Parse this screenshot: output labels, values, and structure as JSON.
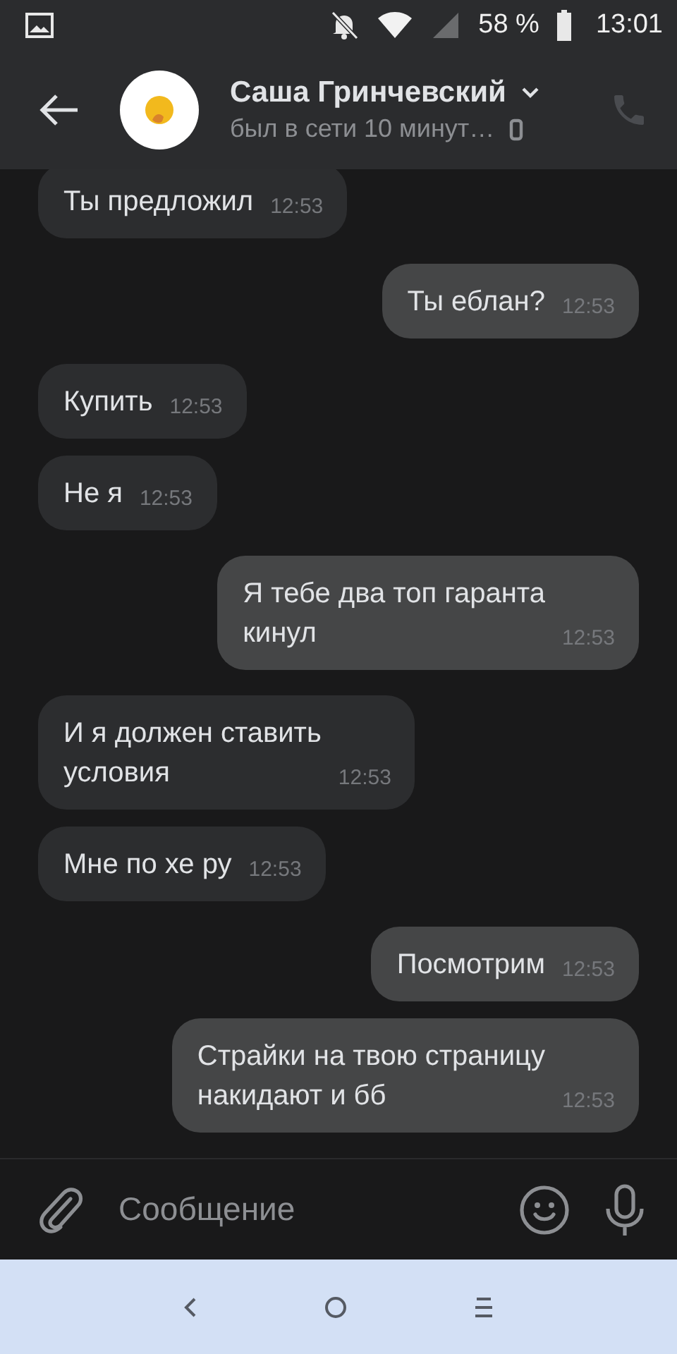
{
  "status_bar": {
    "battery": "58 %",
    "time": "13:01"
  },
  "header": {
    "name": "Саша Гринчевский",
    "status": "был в сети 10 минут…"
  },
  "messages": [
    {
      "text": "Ты предложил",
      "time": "12:53",
      "outgoing": false
    },
    {
      "text": "Ты еблан?",
      "time": "12:53",
      "outgoing": true
    },
    {
      "text": "Купить",
      "time": "12:53",
      "outgoing": false
    },
    {
      "text": "Не я",
      "time": "12:53",
      "outgoing": false
    },
    {
      "text": "Я тебе два топ гаранта\nкинул",
      "time": "12:53",
      "outgoing": true
    },
    {
      "text": "И я должен ставить\nусловия",
      "time": "12:53",
      "outgoing": false
    },
    {
      "text": "Мне по хе ру",
      "time": "12:53",
      "outgoing": false
    },
    {
      "text": "Посмотрим",
      "time": "12:53",
      "outgoing": true
    },
    {
      "text": "Страйки на твою страницу\nнакидают и бб",
      "time": "12:53",
      "outgoing": true
    }
  ],
  "composer": {
    "placeholder": "Сообщение"
  }
}
